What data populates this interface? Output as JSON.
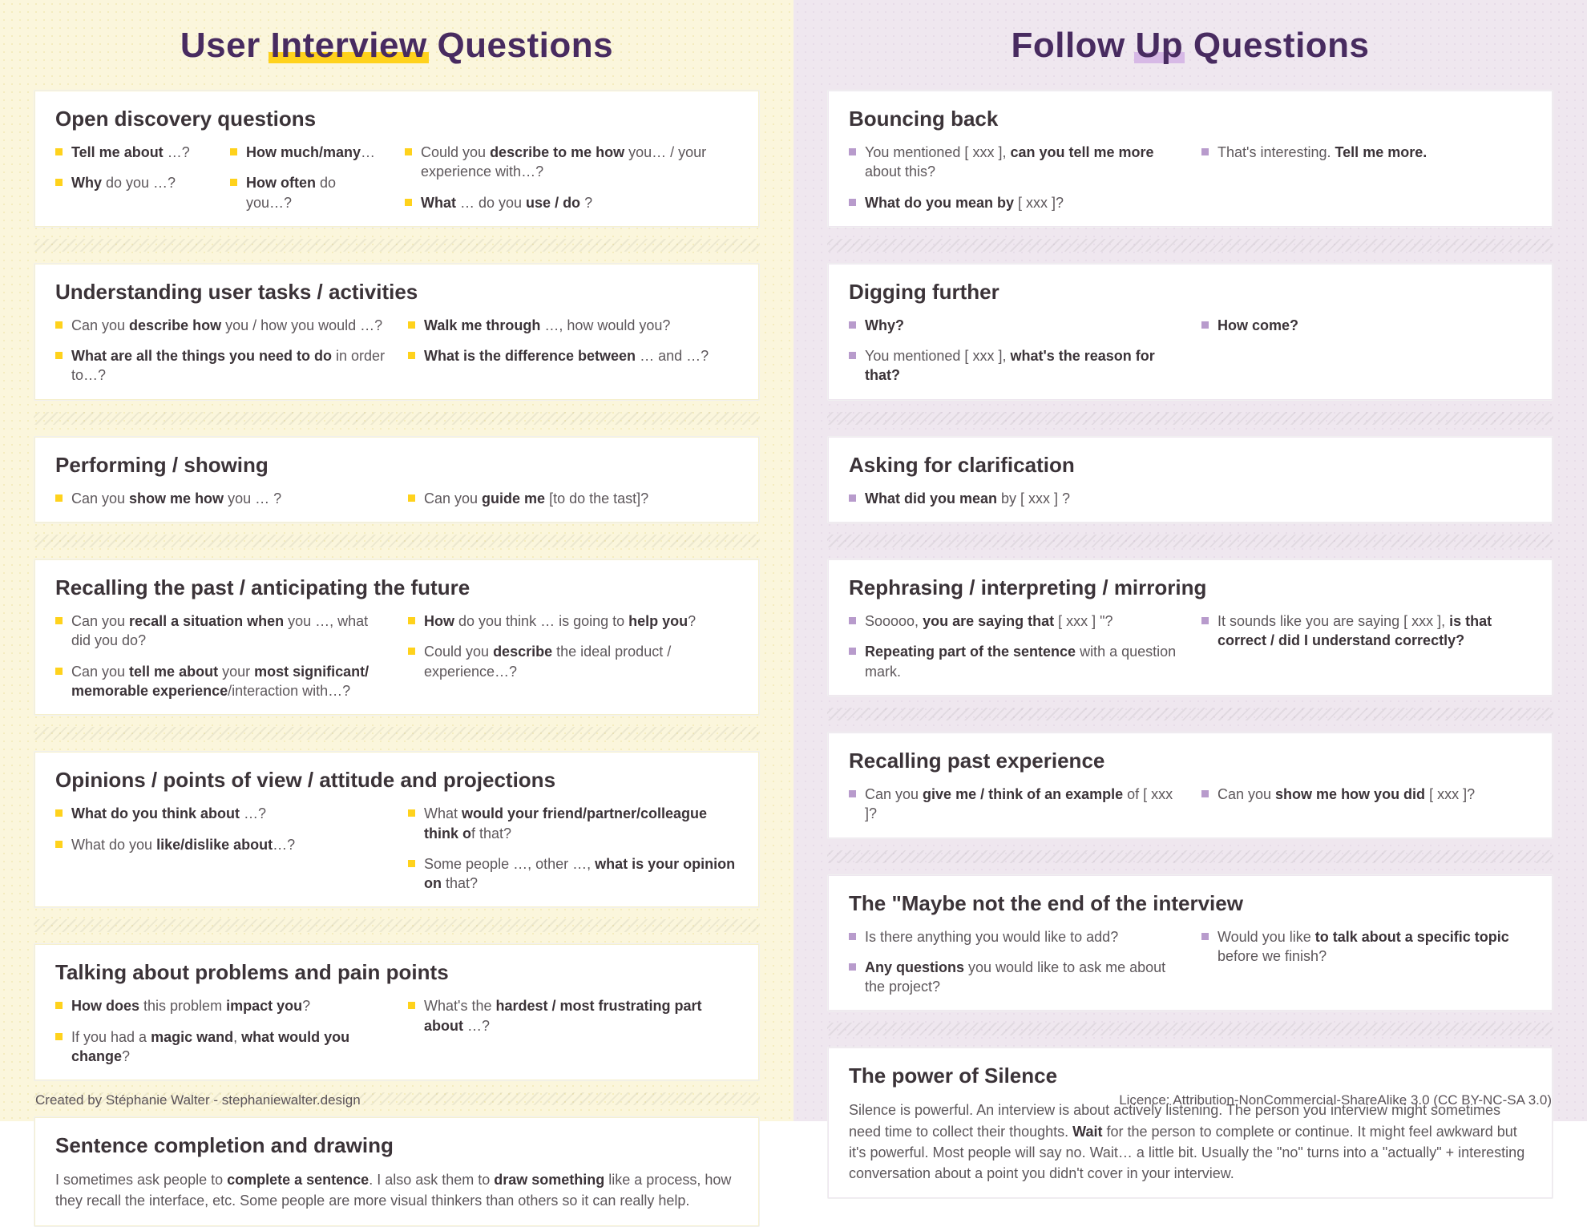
{
  "left": {
    "title_a": "User ",
    "title_hl": "Interview",
    "title_b": " Questions",
    "sections": [
      {
        "heading": "Open discovery questions",
        "layout": "three",
        "cols": [
          [
            "<b>Tell me about</b> …?",
            "<b>Why</b> do you …?"
          ],
          [
            "<b>How much/many</b>…",
            "<b>How often</b> do you…?"
          ],
          [
            "Could you <b>describe to me how</b> you… / your experience with…?",
            "<b>What</b> … do you <b>use / do</b> ?"
          ]
        ]
      },
      {
        "heading": "Understanding user tasks / activities",
        "layout": "two",
        "cols": [
          [
            "Can you <b>describe how</b> you / how you would …?",
            "<b>What are all the things you need to do</b> in order to…?"
          ],
          [
            "<b>Walk me through</b> …, how would you?",
            "<b>What is the difference between</b> … and …?"
          ]
        ]
      },
      {
        "heading": "Performing / showing",
        "layout": "two",
        "cols": [
          [
            "Can you <b>show me how</b> you … ?"
          ],
          [
            "Can you <b>guide me</b> [to do the tast]?"
          ]
        ]
      },
      {
        "heading": "Recalling the past / anticipating the future",
        "layout": "two",
        "cols": [
          [
            "Can you <b>recall a situation when</b> you …, what did you do?",
            "Can you <b>tell me about</b> your <b>most significant/ memorable experience</b>/interaction with…?"
          ],
          [
            "<b>How</b> do you think … is going to <b>help you</b>?",
            "Could you <b>describe</b> the ideal product / experience…?"
          ]
        ]
      },
      {
        "heading": "Opinions / points of view / attitude and projections",
        "layout": "two",
        "cols": [
          [
            "<b>What do you think about</b> …?",
            "What do you <b>like/dislike about</b>…?"
          ],
          [
            "What <b>would your friend/partner/colleague think o</b>f that?",
            "Some people …, other …, <b>what is your opinion on</b> that?"
          ]
        ]
      },
      {
        "heading": "Talking about problems and pain points",
        "layout": "two",
        "cols": [
          [
            "<b>How does</b> this problem <b>impact you</b>?",
            "If you had a <b>magic wand</b>, <b>what would you change</b>?"
          ],
          [
            "What's the <b>hardest / most frustrating part about</b> …?"
          ]
        ]
      },
      {
        "heading": "Sentence completion and drawing",
        "layout": "para",
        "paragraph": "I sometimes ask people to <b>complete a sentence</b>. I also ask them to <b>draw something</b> like a process, how they recall the interface, etc. Some people are more visual thinkers than others so it can really help."
      }
    ]
  },
  "right": {
    "title_a": "Follow ",
    "title_hl": "Up",
    "title_b": " Questions",
    "sections": [
      {
        "heading": "Bouncing back",
        "layout": "two",
        "cols": [
          [
            "You mentioned [ xxx ], <b>can you tell me more</b> about this?",
            "<b>What do you mean by</b> [ xxx ]?"
          ],
          [
            "That's interesting. <b>Tell me more.</b>"
          ]
        ]
      },
      {
        "heading": "Digging further",
        "layout": "two",
        "cols": [
          [
            "<b>Why?</b>",
            "You mentioned [ xxx ], <b>what's the reason for that?</b>"
          ],
          [
            "<b>How come?</b>"
          ]
        ]
      },
      {
        "heading": "Asking for clarification",
        "layout": "one",
        "cols": [
          [
            "<b>What did you mean</b> by [ xxx ] ?"
          ]
        ]
      },
      {
        "heading": "Rephrasing / interpreting / mirroring",
        "layout": "two",
        "cols": [
          [
            "Sooooo, <b>you are saying that</b> [ xxx ] \"?",
            "<b>Repeating part of the sentence</b> with a question mark."
          ],
          [
            "It sounds like you are saying [ xxx ], <b>is that correct / did I understand correctly?</b>"
          ]
        ]
      },
      {
        "heading": "Recalling past experience",
        "layout": "two",
        "cols": [
          [
            "Can you <b>give me / think of an example</b> of [ xxx ]?"
          ],
          [
            "Can you <b>show me how you did</b> [ xxx ]?"
          ]
        ]
      },
      {
        "heading": "The \"Maybe not the end of the interview",
        "layout": "two",
        "cols": [
          [
            "Is there anything you would like to add?",
            "<b>Any questions</b> you would like to ask me about the project?"
          ],
          [
            "Would you like <b>to talk about a specific topic</b> before we finish?"
          ]
        ]
      },
      {
        "heading": "The power of Silence",
        "layout": "para",
        "paragraph": "Silence is powerful. An interview is about actively listening. The person you interview might sometimes need time to collect their thoughts. <b>Wait</b> for the person to complete or continue. It might feel awkward but it's powerful. Most people will say no. Wait… a little bit. Usually the \"no\" turns into a \"actually\" + interesting conversation about a point you didn't cover in your interview."
      }
    ]
  },
  "footer": {
    "credit": "Created by Stéphanie Walter - stephaniewalter.design",
    "licence": "Licence: Attribution-NonCommercial-ShareAlike 3.0 (CC BY-NC-SA 3.0)"
  }
}
